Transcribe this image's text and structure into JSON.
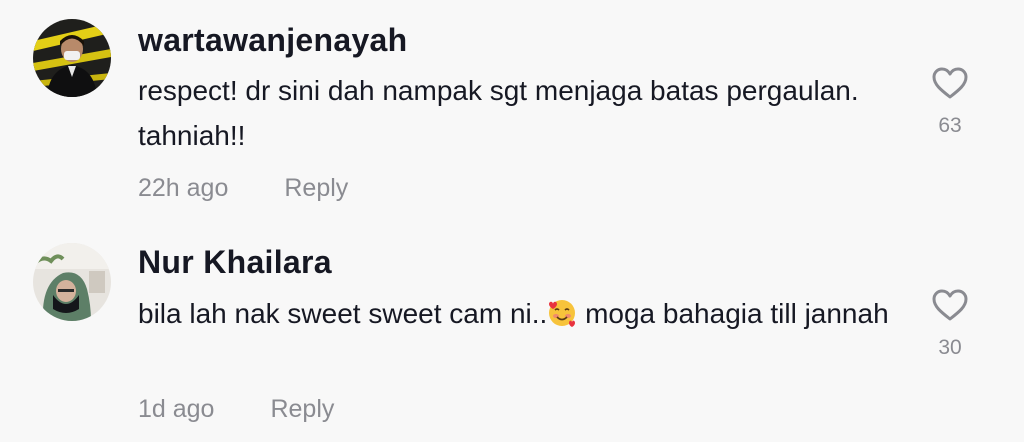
{
  "comments": [
    {
      "username": "wartawanjenayah",
      "text": "respect! dr sini dah nampak sgt menjaga batas pergaulan. tahniah!!",
      "time": "22h ago",
      "reply_label": "Reply",
      "likes": "63",
      "avatar_icon": "avatar-man-masked-crime-tape",
      "heart_icon": "heart-outline-icon"
    },
    {
      "username": "Nur Khailara",
      "text_before_emoji": "bila lah nak sweet sweet cam ni..",
      "emoji": "smiling-face-with-hearts",
      "text_after_emoji": " moga bahagia till jannah",
      "time": "1d ago",
      "reply_label": "Reply",
      "likes": "30",
      "avatar_icon": "avatar-woman-niqab",
      "heart_icon": "heart-outline-icon"
    }
  ],
  "colors": {
    "background": "#f8f8f8",
    "text_primary": "#161823",
    "text_secondary": "#8a8b91"
  }
}
